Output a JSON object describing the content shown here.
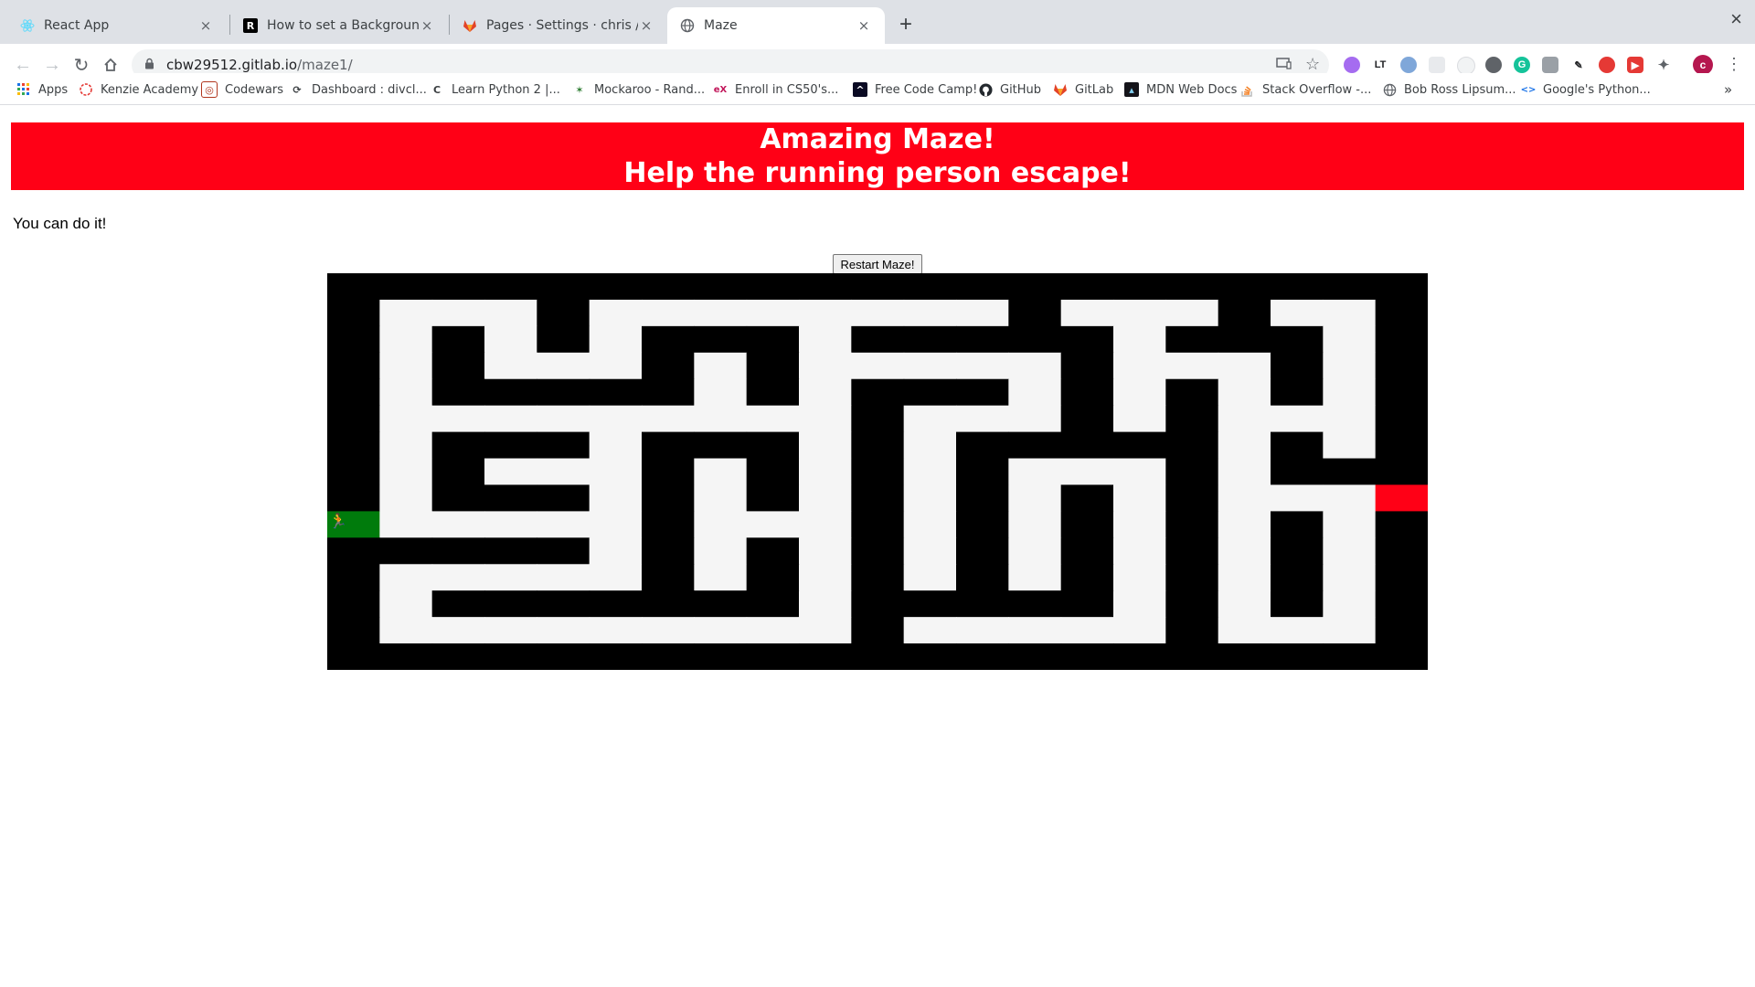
{
  "browser": {
    "tabs": [
      {
        "title": "React App",
        "icon": "react-icon",
        "active": false
      },
      {
        "title": "How to set a Background Image",
        "icon": "r-logo-icon",
        "active": false
      },
      {
        "title": "Pages · Settings · chris / maze",
        "icon": "gitlab-icon",
        "active": false
      },
      {
        "title": "Maze",
        "icon": "globe-icon",
        "active": true
      }
    ],
    "new_tab": "+",
    "close_glyph": "×",
    "url_host": "cbw29512.gitlab.io",
    "url_path": "/maze1/",
    "profile_initial": "c",
    "bookmarks": [
      {
        "label": "Apps",
        "icon": "apps-grid-icon"
      },
      {
        "label": "Kenzie Academy",
        "icon": "kenzie-icon"
      },
      {
        "label": "Codewars",
        "icon": "codewars-icon"
      },
      {
        "label": "Dashboard : divcl...",
        "icon": "divclass-icon"
      },
      {
        "label": "Learn Python 2 |...",
        "icon": "codecademy-icon"
      },
      {
        "label": "Mockaroo - Rand...",
        "icon": "mockaroo-icon"
      },
      {
        "label": "Enroll in CS50's...",
        "icon": "edx-icon"
      },
      {
        "label": "Free Code Camp!",
        "icon": "freecodecamp-icon"
      },
      {
        "label": "GitHub",
        "icon": "github-icon"
      },
      {
        "label": "GitLab",
        "icon": "gitlab-icon"
      },
      {
        "label": "MDN Web Docs",
        "icon": "mdn-icon"
      },
      {
        "label": "Stack Overflow -...",
        "icon": "stackoverflow-icon"
      },
      {
        "label": "Bob Ross Lipsum...",
        "icon": "globe-icon"
      },
      {
        "label": "Google's Python...",
        "icon": "code-icon"
      }
    ],
    "overflow": "»"
  },
  "page": {
    "heading_line1": "Amazing Maze!",
    "heading_line2": "Help the running person escape!",
    "motto": "You can do it!",
    "restart_label": "Restart Maze!",
    "player_icon": "running-person-icon"
  },
  "colors": {
    "banner": "#ff0016",
    "wall": "#000000",
    "floor": "#f5f5f5",
    "start": "#007b0c",
    "finish": "#ff0016"
  },
  "maze": {
    "rows": [
      "WWWWWWWWWWWWWWWWWWWWW",
      "W   W        W   W  W",
      "W W W WWW WWWWW WWW W",
      "W W   W W     W   W W",
      "W WWWWW W WWW W W W W",
      "W         W   W W   W",
      "W WWW WWW W WWWWW W W",
      "W W   W W W W   W WWW",
      "W WWW W W W W W W   F",
      "S     W   W W W W W W",
      "WWWWW W W W W W W W W",
      "W     W W W W W W W W",
      "W WWWWWWW WWWWW W W W",
      "W         W     W   W",
      "WWWWWWWWWWWWWWWWWWWWW"
    ]
  }
}
